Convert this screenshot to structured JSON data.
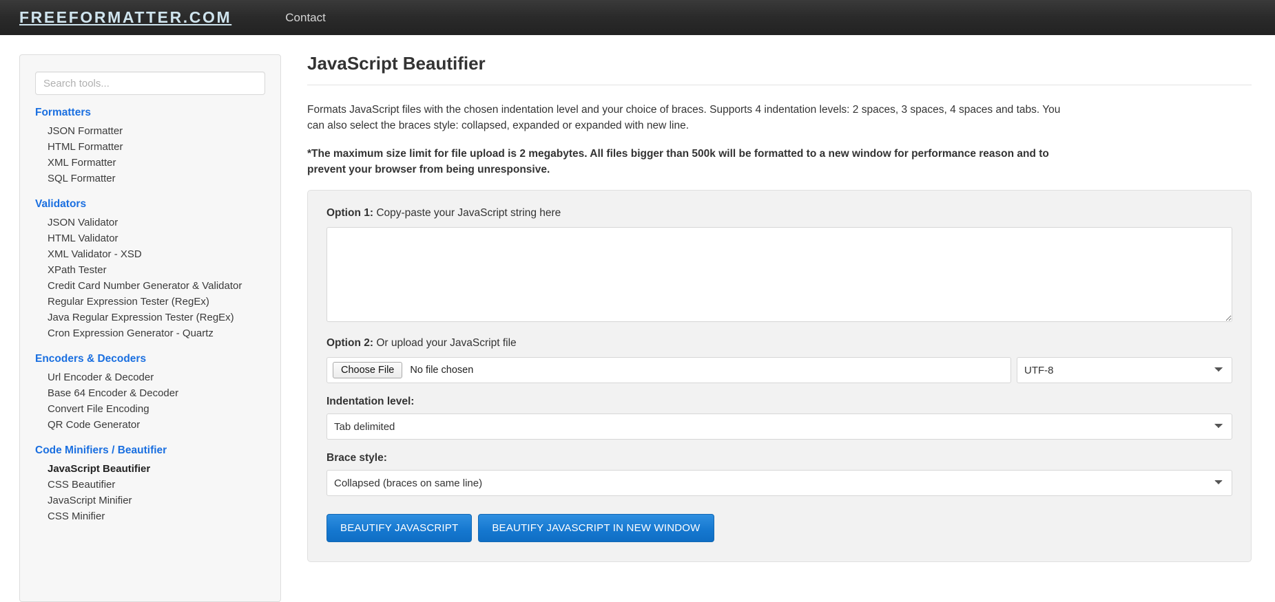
{
  "header": {
    "brand": "FREEFORMATTER.COM",
    "nav": [
      {
        "label": "Contact"
      }
    ]
  },
  "sidebar": {
    "search_placeholder": "Search tools...",
    "search_value": "",
    "groups": [
      {
        "title": "Formatters",
        "items": [
          {
            "label": "JSON Formatter",
            "active": false
          },
          {
            "label": "HTML Formatter",
            "active": false
          },
          {
            "label": "XML Formatter",
            "active": false
          },
          {
            "label": "SQL Formatter",
            "active": false
          }
        ]
      },
      {
        "title": "Validators",
        "items": [
          {
            "label": "JSON Validator",
            "active": false
          },
          {
            "label": "HTML Validator",
            "active": false
          },
          {
            "label": "XML Validator - XSD",
            "active": false
          },
          {
            "label": "XPath Tester",
            "active": false
          },
          {
            "label": "Credit Card Number Generator & Validator",
            "active": false
          },
          {
            "label": "Regular Expression Tester (RegEx)",
            "active": false
          },
          {
            "label": "Java Regular Expression Tester (RegEx)",
            "active": false
          },
          {
            "label": "Cron Expression Generator - Quartz",
            "active": false
          }
        ]
      },
      {
        "title": "Encoders & Decoders",
        "items": [
          {
            "label": "Url Encoder & Decoder",
            "active": false
          },
          {
            "label": "Base 64 Encoder & Decoder",
            "active": false
          },
          {
            "label": "Convert File Encoding",
            "active": false
          },
          {
            "label": "QR Code Generator",
            "active": false
          }
        ]
      },
      {
        "title": "Code Minifiers / Beautifier",
        "items": [
          {
            "label": "JavaScript Beautifier",
            "active": true
          },
          {
            "label": "CSS Beautifier",
            "active": false
          },
          {
            "label": "JavaScript Minifier",
            "active": false
          },
          {
            "label": "CSS Minifier",
            "active": false
          }
        ]
      }
    ]
  },
  "main": {
    "title": "JavaScript Beautifier",
    "description": "Formats JavaScript files with the chosen indentation level and your choice of braces. Supports 4 indentation levels: 2 spaces, 3 spaces, 4 spaces and tabs. You can also select the braces style: collapsed, expanded or expanded with new line.",
    "warning": "*The maximum size limit for file upload is 2 megabytes. All files bigger than 500k will be formatted to a new window for performance reason and to prevent your browser from being unresponsive.",
    "form": {
      "option1_prefix": "Option 1:",
      "option1_text": " Copy-paste your JavaScript string here",
      "textarea_value": "",
      "option2_prefix": "Option 2:",
      "option2_text": " Or upload your JavaScript file",
      "choose_file_label": "Choose File",
      "file_status": "No file chosen",
      "encoding_selected": "UTF-8",
      "encoding_options": [
        "UTF-8"
      ],
      "indentation_label": "Indentation level:",
      "indentation_selected": "Tab delimited",
      "indentation_options": [
        "Tab delimited"
      ],
      "brace_label": "Brace style:",
      "brace_selected": "Collapsed (braces on same line)",
      "brace_options": [
        "Collapsed (braces on same line)"
      ],
      "beautify_button": "BEAUTIFY JAVASCRIPT",
      "beautify_new_window_button": "BEAUTIFY JAVASCRIPT IN NEW WINDOW"
    }
  },
  "colors": {
    "accent_blue": "#1a6fe0",
    "button_blue": "#1577cf",
    "header_dark": "#2a2a2a",
    "brand_text": "#cfe4ee"
  }
}
